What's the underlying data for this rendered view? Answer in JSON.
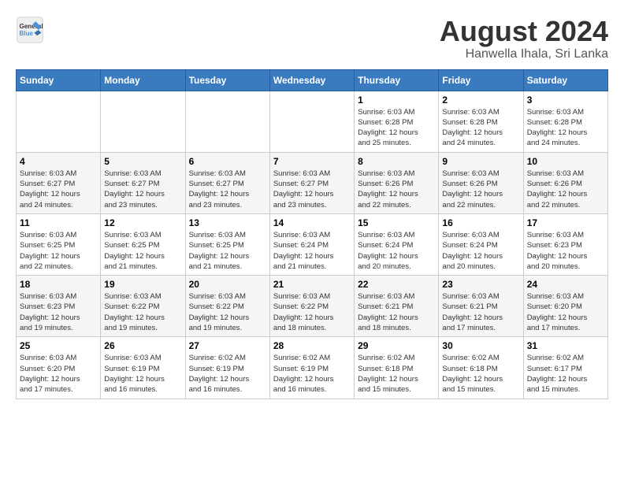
{
  "header": {
    "logo_line1": "General",
    "logo_line2": "Blue",
    "title": "August 2024",
    "subtitle": "Hanwella Ihala, Sri Lanka"
  },
  "weekdays": [
    "Sunday",
    "Monday",
    "Tuesday",
    "Wednesday",
    "Thursday",
    "Friday",
    "Saturday"
  ],
  "weeks": [
    [
      {
        "day": "",
        "info": ""
      },
      {
        "day": "",
        "info": ""
      },
      {
        "day": "",
        "info": ""
      },
      {
        "day": "",
        "info": ""
      },
      {
        "day": "1",
        "info": "Sunrise: 6:03 AM\nSunset: 6:28 PM\nDaylight: 12 hours\nand 25 minutes."
      },
      {
        "day": "2",
        "info": "Sunrise: 6:03 AM\nSunset: 6:28 PM\nDaylight: 12 hours\nand 24 minutes."
      },
      {
        "day": "3",
        "info": "Sunrise: 6:03 AM\nSunset: 6:28 PM\nDaylight: 12 hours\nand 24 minutes."
      }
    ],
    [
      {
        "day": "4",
        "info": "Sunrise: 6:03 AM\nSunset: 6:27 PM\nDaylight: 12 hours\nand 24 minutes."
      },
      {
        "day": "5",
        "info": "Sunrise: 6:03 AM\nSunset: 6:27 PM\nDaylight: 12 hours\nand 23 minutes."
      },
      {
        "day": "6",
        "info": "Sunrise: 6:03 AM\nSunset: 6:27 PM\nDaylight: 12 hours\nand 23 minutes."
      },
      {
        "day": "7",
        "info": "Sunrise: 6:03 AM\nSunset: 6:27 PM\nDaylight: 12 hours\nand 23 minutes."
      },
      {
        "day": "8",
        "info": "Sunrise: 6:03 AM\nSunset: 6:26 PM\nDaylight: 12 hours\nand 22 minutes."
      },
      {
        "day": "9",
        "info": "Sunrise: 6:03 AM\nSunset: 6:26 PM\nDaylight: 12 hours\nand 22 minutes."
      },
      {
        "day": "10",
        "info": "Sunrise: 6:03 AM\nSunset: 6:26 PM\nDaylight: 12 hours\nand 22 minutes."
      }
    ],
    [
      {
        "day": "11",
        "info": "Sunrise: 6:03 AM\nSunset: 6:25 PM\nDaylight: 12 hours\nand 22 minutes."
      },
      {
        "day": "12",
        "info": "Sunrise: 6:03 AM\nSunset: 6:25 PM\nDaylight: 12 hours\nand 21 minutes."
      },
      {
        "day": "13",
        "info": "Sunrise: 6:03 AM\nSunset: 6:25 PM\nDaylight: 12 hours\nand 21 minutes."
      },
      {
        "day": "14",
        "info": "Sunrise: 6:03 AM\nSunset: 6:24 PM\nDaylight: 12 hours\nand 21 minutes."
      },
      {
        "day": "15",
        "info": "Sunrise: 6:03 AM\nSunset: 6:24 PM\nDaylight: 12 hours\nand 20 minutes."
      },
      {
        "day": "16",
        "info": "Sunrise: 6:03 AM\nSunset: 6:24 PM\nDaylight: 12 hours\nand 20 minutes."
      },
      {
        "day": "17",
        "info": "Sunrise: 6:03 AM\nSunset: 6:23 PM\nDaylight: 12 hours\nand 20 minutes."
      }
    ],
    [
      {
        "day": "18",
        "info": "Sunrise: 6:03 AM\nSunset: 6:23 PM\nDaylight: 12 hours\nand 19 minutes."
      },
      {
        "day": "19",
        "info": "Sunrise: 6:03 AM\nSunset: 6:22 PM\nDaylight: 12 hours\nand 19 minutes."
      },
      {
        "day": "20",
        "info": "Sunrise: 6:03 AM\nSunset: 6:22 PM\nDaylight: 12 hours\nand 19 minutes."
      },
      {
        "day": "21",
        "info": "Sunrise: 6:03 AM\nSunset: 6:22 PM\nDaylight: 12 hours\nand 18 minutes."
      },
      {
        "day": "22",
        "info": "Sunrise: 6:03 AM\nSunset: 6:21 PM\nDaylight: 12 hours\nand 18 minutes."
      },
      {
        "day": "23",
        "info": "Sunrise: 6:03 AM\nSunset: 6:21 PM\nDaylight: 12 hours\nand 17 minutes."
      },
      {
        "day": "24",
        "info": "Sunrise: 6:03 AM\nSunset: 6:20 PM\nDaylight: 12 hours\nand 17 minutes."
      }
    ],
    [
      {
        "day": "25",
        "info": "Sunrise: 6:03 AM\nSunset: 6:20 PM\nDaylight: 12 hours\nand 17 minutes."
      },
      {
        "day": "26",
        "info": "Sunrise: 6:03 AM\nSunset: 6:19 PM\nDaylight: 12 hours\nand 16 minutes."
      },
      {
        "day": "27",
        "info": "Sunrise: 6:02 AM\nSunset: 6:19 PM\nDaylight: 12 hours\nand 16 minutes."
      },
      {
        "day": "28",
        "info": "Sunrise: 6:02 AM\nSunset: 6:19 PM\nDaylight: 12 hours\nand 16 minutes."
      },
      {
        "day": "29",
        "info": "Sunrise: 6:02 AM\nSunset: 6:18 PM\nDaylight: 12 hours\nand 15 minutes."
      },
      {
        "day": "30",
        "info": "Sunrise: 6:02 AM\nSunset: 6:18 PM\nDaylight: 12 hours\nand 15 minutes."
      },
      {
        "day": "31",
        "info": "Sunrise: 6:02 AM\nSunset: 6:17 PM\nDaylight: 12 hours\nand 15 minutes."
      }
    ]
  ]
}
